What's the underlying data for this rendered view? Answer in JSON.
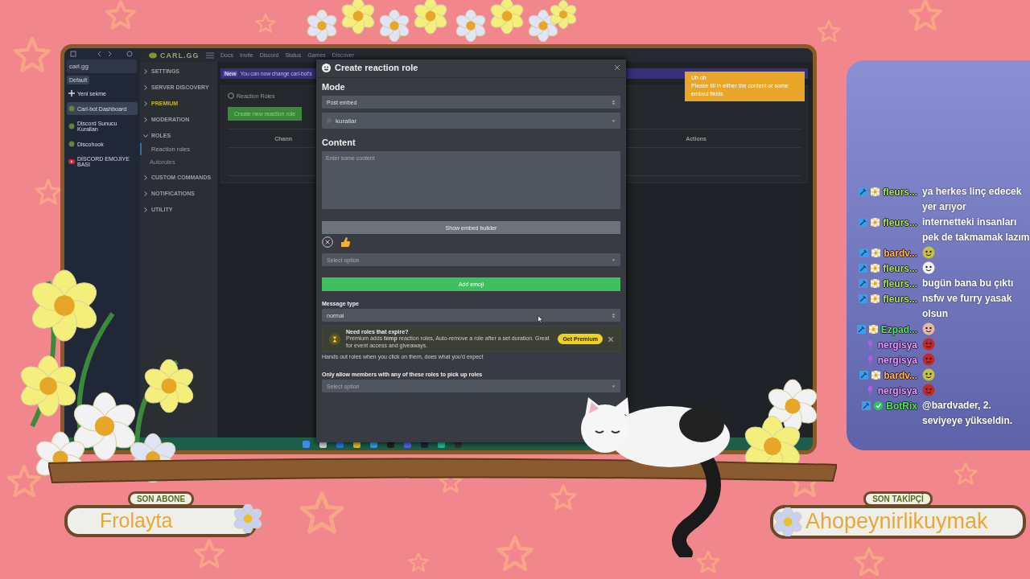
{
  "browser": {
    "address": "carl.gg",
    "profile": "Default",
    "tabs": [
      {
        "label": "Yeni sekme",
        "kind": "new",
        "selected": false
      },
      {
        "label": "Carl-bot Dashboard",
        "kind": "page",
        "selected": true
      },
      {
        "label": "Discord Sunucu Kuralları",
        "kind": "page",
        "selected": false
      },
      {
        "label": "Discohook",
        "kind": "page",
        "selected": false
      },
      {
        "label": "DİSCORD EMOJİYE BASI",
        "kind": "video",
        "selected": false
      }
    ]
  },
  "dashboard": {
    "logo": "CARL.GG",
    "nav_links": [
      "Docs",
      "Invite",
      "Discord",
      "Status",
      "Games",
      "Discover"
    ],
    "sidebar": [
      {
        "label": "SETTINGS",
        "kind": "section",
        "expanded": false
      },
      {
        "label": "SERVER DISCOVERY",
        "kind": "section",
        "expanded": false
      },
      {
        "label": "PREMIUM",
        "kind": "premium",
        "expanded": false
      },
      {
        "label": "MODERATION",
        "kind": "section",
        "expanded": false
      },
      {
        "label": "ROLES",
        "kind": "section",
        "expanded": true,
        "children": [
          {
            "label": "Reaction roles",
            "selected": true
          },
          {
            "label": "Autoroles",
            "selected": false
          }
        ]
      },
      {
        "label": "CUSTOM COMMANDS",
        "kind": "section",
        "expanded": false
      },
      {
        "label": "NOTIFICATIONS",
        "kind": "section",
        "expanded": false
      },
      {
        "label": "UTILITY",
        "kind": "section",
        "expanded": false
      }
    ],
    "banner": {
      "badge": "New",
      "text": "You can now change carl-bot's"
    },
    "panel": {
      "title": "Reaction Roles",
      "create_button": "Create new reaction role",
      "columns": [
        "Chann",
        "Actions"
      ]
    }
  },
  "modal": {
    "title": "Create reaction role",
    "mode_heading": "Mode",
    "mode_value": "Post embed",
    "channel_value": "kurallar",
    "content_heading": "Content",
    "content_placeholder": "Enter some content",
    "embed_button": "Show embed builder",
    "role_placeholder": "Select option",
    "add_emoji_button": "Add emoji",
    "message_type_label": "Message type",
    "message_type_value": "normal",
    "promo": {
      "title": "Need roles that expire?",
      "text": "Premium adds **temp** reaction roles, Auto-remove a role after a set duration. Great for event access and giveaways.",
      "button": "Get Premium"
    },
    "message_type_help": "Hands out roles when you click on them, does what you'd expect",
    "allow_label": "Only allow members with any of these roles to pick up roles",
    "allow_placeholder": "Select option"
  },
  "toast": {
    "title": "Uh oh",
    "message": "Please fill in either the content or some embed fields"
  },
  "chat": [
    {
      "name": "fleurs...",
      "color": "#a6e35a",
      "badges": [
        {
          "kind": "mod"
        },
        {
          "kind": "flower"
        }
      ],
      "kind": "text",
      "text": "ya herkes linç edecek yer arıyor"
    },
    {
      "name": "fleurs...",
      "color": "#a6e35a",
      "badges": [
        {
          "kind": "mod"
        },
        {
          "kind": "flower"
        }
      ],
      "kind": "text",
      "text": "internetteki insanları pek de takmamak lazım"
    },
    {
      "name": "bardv...",
      "color": "#ffb54a",
      "badges": [
        {
          "kind": "mod"
        },
        {
          "kind": "flower"
        }
      ],
      "kind": "emote",
      "emote": {
        "color": "#c8c040"
      }
    },
    {
      "name": "fleurs...",
      "color": "#a6e35a",
      "badges": [
        {
          "kind": "mod"
        },
        {
          "kind": "flower"
        }
      ],
      "kind": "emote",
      "emote": {
        "color": "#f2f2f2"
      }
    },
    {
      "name": "fleurs...",
      "color": "#a6e35a",
      "badges": [
        {
          "kind": "mod"
        },
        {
          "kind": "flower"
        }
      ],
      "kind": "text",
      "text": "bugün bana bu çıktı"
    },
    {
      "name": "fleurs...",
      "color": "#a6e35a",
      "badges": [
        {
          "kind": "mod"
        },
        {
          "kind": "flower"
        }
      ],
      "kind": "text",
      "text": "nsfw ve furry yasak olsun"
    },
    {
      "name": "Ezpad...",
      "color": "#4ee35a",
      "badges": [
        {
          "kind": "mod"
        },
        {
          "kind": "flower"
        }
      ],
      "kind": "emote",
      "emote": {
        "color": "#e8b8a0"
      }
    },
    {
      "name": "nergisya",
      "color": "#e09cff",
      "badges": [
        {
          "kind": "mic"
        }
      ],
      "kind": "emote",
      "emote": {
        "color": "#c02a2a"
      }
    },
    {
      "name": "nergisya",
      "color": "#e09cff",
      "badges": [
        {
          "kind": "mic"
        }
      ],
      "kind": "emote",
      "emote": {
        "color": "#c02a2a"
      }
    },
    {
      "name": "bardv...",
      "color": "#ffb54a",
      "badges": [
        {
          "kind": "mod"
        },
        {
          "kind": "flower"
        }
      ],
      "kind": "emote",
      "emote": {
        "color": "#c8c040"
      }
    },
    {
      "name": "nergisya",
      "color": "#e09cff",
      "badges": [
        {
          "kind": "mic"
        }
      ],
      "kind": "emote",
      "emote": {
        "color": "#c02a2a"
      }
    },
    {
      "name": "BotRix",
      "color": "#4ee35a",
      "badges": [
        {
          "kind": "mod"
        },
        {
          "kind": "verified"
        }
      ],
      "kind": "text",
      "text": "@bardvader, 2. seviyeye yükseldin."
    }
  ],
  "last_subscriber": {
    "label": "SON ABONE",
    "name": "Frolayta"
  },
  "last_follower": {
    "label": "SON TAKİPÇİ",
    "name": "Ahopeynirlikuymak"
  }
}
